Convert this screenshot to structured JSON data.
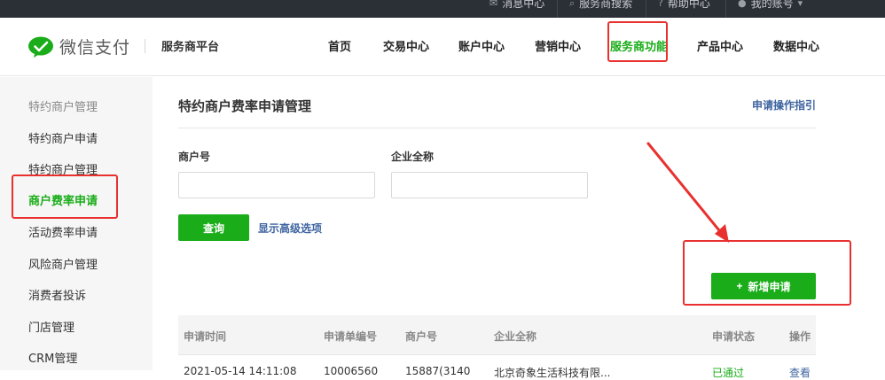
{
  "topbar": {
    "items": [
      {
        "label": "消息中心",
        "icon": "envelope-icon"
      },
      {
        "label": "服务商搜索",
        "icon": "search-icon"
      },
      {
        "label": "帮助中心",
        "icon": "help-icon"
      },
      {
        "label": "我的账号",
        "icon": "user-icon"
      }
    ]
  },
  "header": {
    "logo_text": "微信支付",
    "platform": "服务商平台",
    "nav": [
      "首页",
      "交易中心",
      "账户中心",
      "营销中心",
      "服务商功能",
      "产品中心",
      "数据中心"
    ],
    "active_nav": "服务商功能"
  },
  "sidebar": {
    "items": [
      "特约商户管理",
      "特约商户申请",
      "特约商户管理",
      "商户费率申请",
      "活动费率申请",
      "风险商户管理",
      "消费者投诉",
      "门店管理",
      "CRM管理"
    ],
    "active": "商户费率申请"
  },
  "main": {
    "title": "特约商户费率申请管理",
    "guide_link": "申请操作指引",
    "merchant_id_label": "商户号",
    "merchant_id_value": "",
    "company_label": "企业全称",
    "company_value": "",
    "query_button": "查询",
    "advanced_link": "显示高级选项",
    "new_button": "新增申请"
  },
  "table": {
    "columns": [
      "申请时间",
      "申请单编号",
      "商户号",
      "企业全称",
      "申请状态",
      "操作"
    ],
    "rows": [
      [
        "2021-05-14 14:11:08",
        "10006560",
        "15887(3140",
        "北京奇象生活科技有限...",
        "已通过",
        "查看"
      ]
    ]
  },
  "colors": {
    "brand_green": "#1aad19",
    "link_blue": "#3e64a0",
    "annotation_red": "#e8312f",
    "topbar_bg": "#2b2f36"
  }
}
